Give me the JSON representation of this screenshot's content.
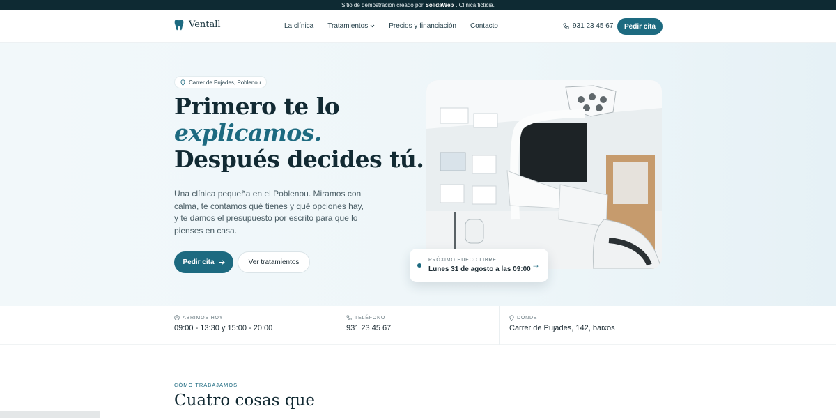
{
  "topbar": {
    "text_before": "Sitio de demostración creado por",
    "link": "SolidaWeb",
    "text_after": ". Clínica ficticia."
  },
  "header": {
    "logo_text": "Ventall",
    "nav": [
      "La clínica",
      "Tratamientos",
      "Precios y financiación",
      "Contacto"
    ],
    "phone": "931 23 45 67",
    "cta": "Pedir cita"
  },
  "hero": {
    "badge": "Carrer de Pujades, Poblenou",
    "title_line1": "Primero te lo",
    "title_line2": "explicamos.",
    "title_line3": "Después decides tú.",
    "lead": "Una clínica pequeña en el Poblenou. Miramos con calma, te contamos qué tienes y qué opciones hay, y te damos el presupuesto por escrito para que lo pienses en casa.",
    "primary_button": "Pedir cita",
    "secondary_button": "Ver tratamientos",
    "next_slot_label": "PRÓXIMO HUECO LIBRE",
    "next_slot_value": "Lunes 31 de agosto a las 09:00"
  },
  "info": [
    {
      "label": "ABRIMOS HOY",
      "value": "09:00 - 13:30 y 15:00 - 20:00",
      "icon": "clock-icon"
    },
    {
      "label": "TELÉFONO",
      "value": "931 23 45 67",
      "icon": "phone-icon"
    },
    {
      "label": "DÓNDE",
      "value": "Carrer de Pujades, 142, baixos",
      "icon": "map-pin-icon"
    }
  ],
  "section": {
    "label": "CÓMO TRABAJAMOS",
    "title": "Cuatro cosas que"
  },
  "colors": {
    "accent": "#1d6a80",
    "dark": "#0e2a33"
  }
}
